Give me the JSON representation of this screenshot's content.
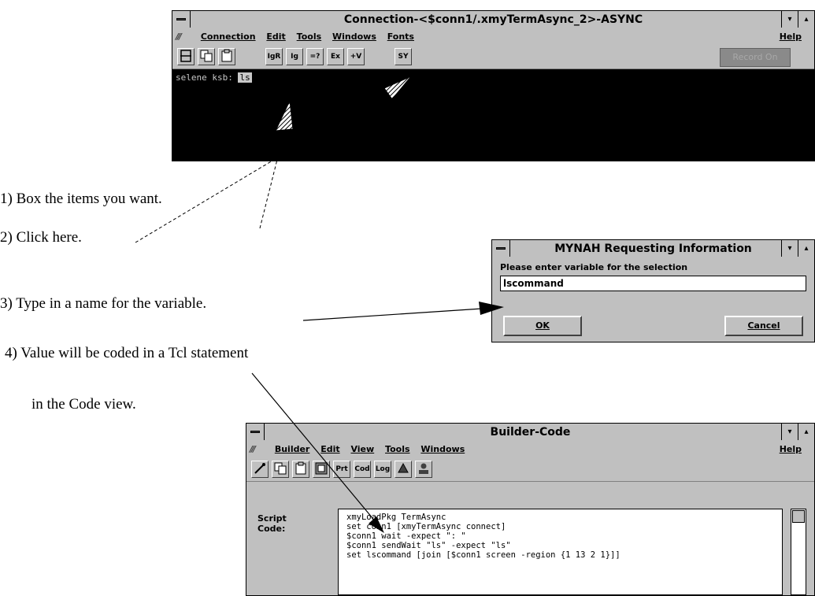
{
  "conn_window": {
    "title": "Connection-<$conn1/.xmyTermAsync_2>-ASYNC",
    "min_btn": "▾",
    "max_btn": "▴",
    "menu_logo": "///",
    "menus": [
      "Connection",
      "Edit",
      "Tools",
      "Windows",
      "Fonts"
    ],
    "help": "Help",
    "toolbar": [
      "",
      "",
      "",
      "",
      "IgR",
      "Ig",
      "=?",
      "Ex",
      "+V",
      "",
      "SY"
    ],
    "record_label": "Record On",
    "terminal_prompt": "selene ksb: ",
    "terminal_selection": "ls"
  },
  "steps": [
    "1) Box the items you want.",
    "2) Click here.",
    "3) Type in a name for the variable.",
    "4) Value will be coded in a Tcl statement",
    "in the Code view."
  ],
  "dialog": {
    "title": "MYNAH Requesting Information",
    "min_btn": "▾",
    "max_btn": "▴",
    "prompt": "Please enter variable for the selection",
    "value": "lscommand",
    "ok": "OK",
    "cancel": "Cancel"
  },
  "builder": {
    "title": "Builder-Code",
    "min_btn": "▾",
    "max_btn": "▴",
    "menu_logo": "///",
    "menus": [
      "Builder",
      "Edit",
      "View",
      "Tools",
      "Windows"
    ],
    "help": "Help",
    "toolbar": [
      "",
      "",
      "",
      "",
      "Prt",
      "Cod",
      "Log",
      "",
      ""
    ],
    "label_line1": "Script",
    "label_line2": "Code:",
    "code": [
      "xmyLoadPkg TermAsync",
      "set conn1 [xmyTermAsync connect]",
      "$conn1 wait -expect \": \"",
      "$conn1 sendWait \"ls\" -expect \"ls\"",
      "set lscommand [join [$conn1 screen -region {1 13 2 1}]]"
    ]
  }
}
